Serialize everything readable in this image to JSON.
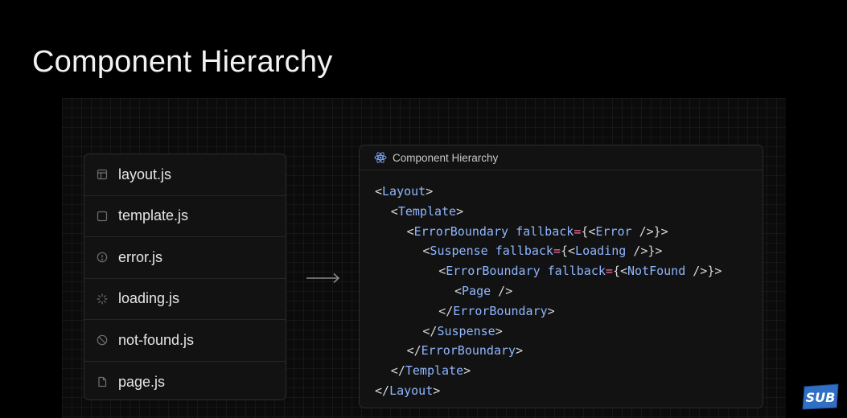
{
  "slide": {
    "title": "Component Hierarchy"
  },
  "files": [
    {
      "name": "layout.js",
      "icon": "layout-icon"
    },
    {
      "name": "template.js",
      "icon": "square-icon"
    },
    {
      "name": "error.js",
      "icon": "alert-circle-icon"
    },
    {
      "name": "loading.js",
      "icon": "spinner-icon"
    },
    {
      "name": "not-found.js",
      "icon": "ban-icon"
    },
    {
      "name": "page.js",
      "icon": "file-icon"
    }
  ],
  "code_panel": {
    "header": "Component Hierarchy",
    "lines": [
      {
        "indent": 0,
        "tokens": [
          {
            "c": "p",
            "v": "<"
          },
          {
            "c": "t",
            "v": "Layout"
          },
          {
            "c": "p",
            "v": ">"
          }
        ]
      },
      {
        "indent": 1,
        "tokens": [
          {
            "c": "p",
            "v": "<"
          },
          {
            "c": "t",
            "v": "Template"
          },
          {
            "c": "p",
            "v": ">"
          }
        ]
      },
      {
        "indent": 2,
        "tokens": [
          {
            "c": "p",
            "v": "<"
          },
          {
            "c": "t",
            "v": "ErrorBoundary"
          },
          {
            "c": "p",
            "v": " "
          },
          {
            "c": "t",
            "v": "fallback"
          },
          {
            "c": "a",
            "v": "="
          },
          {
            "c": "p",
            "v": "{<"
          },
          {
            "c": "t",
            "v": "Error"
          },
          {
            "c": "p",
            "v": " />}>"
          }
        ]
      },
      {
        "indent": 3,
        "tokens": [
          {
            "c": "p",
            "v": "<"
          },
          {
            "c": "t",
            "v": "Suspense"
          },
          {
            "c": "p",
            "v": " "
          },
          {
            "c": "t",
            "v": "fallback"
          },
          {
            "c": "a",
            "v": "="
          },
          {
            "c": "p",
            "v": "{<"
          },
          {
            "c": "t",
            "v": "Loading"
          },
          {
            "c": "p",
            "v": " />}>"
          }
        ]
      },
      {
        "indent": 4,
        "tokens": [
          {
            "c": "p",
            "v": "<"
          },
          {
            "c": "t",
            "v": "ErrorBoundary"
          },
          {
            "c": "p",
            "v": " "
          },
          {
            "c": "t",
            "v": "fallback"
          },
          {
            "c": "a",
            "v": "="
          },
          {
            "c": "p",
            "v": "{<"
          },
          {
            "c": "t",
            "v": "NotFound"
          },
          {
            "c": "p",
            "v": " />}>"
          }
        ]
      },
      {
        "indent": 5,
        "tokens": [
          {
            "c": "p",
            "v": "<"
          },
          {
            "c": "t",
            "v": "Page"
          },
          {
            "c": "p",
            "v": " />"
          }
        ]
      },
      {
        "indent": 4,
        "tokens": [
          {
            "c": "p",
            "v": "</"
          },
          {
            "c": "t",
            "v": "ErrorBoundary"
          },
          {
            "c": "p",
            "v": ">"
          }
        ]
      },
      {
        "indent": 3,
        "tokens": [
          {
            "c": "p",
            "v": "</"
          },
          {
            "c": "t",
            "v": "Suspense"
          },
          {
            "c": "p",
            "v": ">"
          }
        ]
      },
      {
        "indent": 2,
        "tokens": [
          {
            "c": "p",
            "v": "</"
          },
          {
            "c": "t",
            "v": "ErrorBoundary"
          },
          {
            "c": "p",
            "v": ">"
          }
        ]
      },
      {
        "indent": 1,
        "tokens": [
          {
            "c": "p",
            "v": "</"
          },
          {
            "c": "t",
            "v": "Template"
          },
          {
            "c": "p",
            "v": ">"
          }
        ]
      },
      {
        "indent": 0,
        "tokens": [
          {
            "c": "p",
            "v": "</"
          },
          {
            "c": "t",
            "v": "Layout"
          },
          {
            "c": "p",
            "v": ">"
          }
        ]
      }
    ]
  },
  "badge": {
    "label": "SUB"
  },
  "colors": {
    "background": "#000000",
    "tag": "#8fb6ff",
    "operator": "#ff6fa8",
    "punctuation": "#d6d6d6",
    "react_icon": "#7fa8ff",
    "badge": "#2f6fc4"
  }
}
